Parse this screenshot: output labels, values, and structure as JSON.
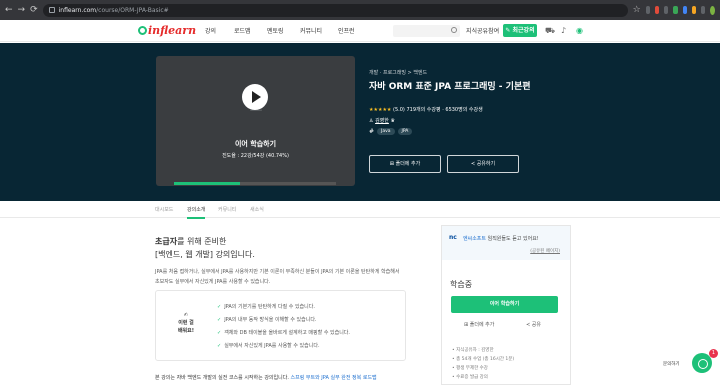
{
  "browser": {
    "url_host": "inflearn.com",
    "url_path": "/course/ORM-JPA-Basic#"
  },
  "nav": {
    "logo": "inflearn",
    "links": [
      "강의",
      "로드맵",
      "멘토링",
      "커뮤니티",
      "인프런"
    ],
    "share_text": "지식공유참여",
    "cta": "최근강의"
  },
  "hero": {
    "resume_label": "이어 학습하기",
    "progress_text": "진도율 : 22강/54강 (40.74%)",
    "progress_fraction": 0.4074,
    "breadcrumb": "개발 · 프로그래밍 > 백엔드",
    "title": "자바 ORM 표준 JPA 프로그래밍 - 기본편",
    "rating": "(5.0)",
    "reviews": "719개의 수강평",
    "students": "6530명의 수강생",
    "instructor": "김영한",
    "tags": [
      "Java",
      "JPA"
    ],
    "wishlist_label": "폴더에 추가",
    "share_label": "공유하기"
  },
  "tabs": [
    "대시보드",
    "강의소개",
    "커뮤니티",
    "새소식"
  ],
  "main": {
    "heading_line1_bold": "초급자",
    "heading_line1_rest": "를 위해 준비한",
    "heading_line2": "[백엔드, 웹 개발] 강의입니다.",
    "intro": "JPA를 처음 접하거나, 실무에서 JPA를 사용하지만 기본 이론이 부족하신 분들이 JPA의 기본 이론을 탄탄하게 학습해서 초보자도 실무에서 자신있게 JPA를 사용할 수 있습니다.",
    "learn_title_1": "이런 걸",
    "learn_title_2": "배워요!",
    "learn_items": [
      "JPA의 기본기를 탄탄하게 다질 수 있습니다.",
      "JPA의 내부 동작 방식을 이해할 수 있습니다.",
      "객체와 DB 테이블을 올바르게 설계하고 매핑할 수 있습니다.",
      "실무에서 자신있게 JPA를 사용할 수 있습니다."
    ],
    "bottom_text": "본 강의는 자바 백엔드 개발의 실전 코스를 시작하는 강의입니다.",
    "bottom_link": "스프링 부트와 JPA 실무 완전 정복 로드맵"
  },
  "sidebar": {
    "promo_logo": "nc",
    "promo_company": "엔씨소프트",
    "promo_text": "임직원들도 듣고 있어요!",
    "promo_link": "(공유된 페이지)",
    "status": "학습중",
    "cta": "이어 학습하기",
    "folder_label": "폴더에 추가",
    "share_label": "공유",
    "info": [
      "지식공유자 : 김영한",
      "총 54개 수업 (총 16시간 1분)",
      "평생 무제한 수강",
      "수료증 발급 강의",
      "수강 난이도 초급"
    ]
  },
  "chat": {
    "label": "문의하기",
    "badge": "1"
  }
}
